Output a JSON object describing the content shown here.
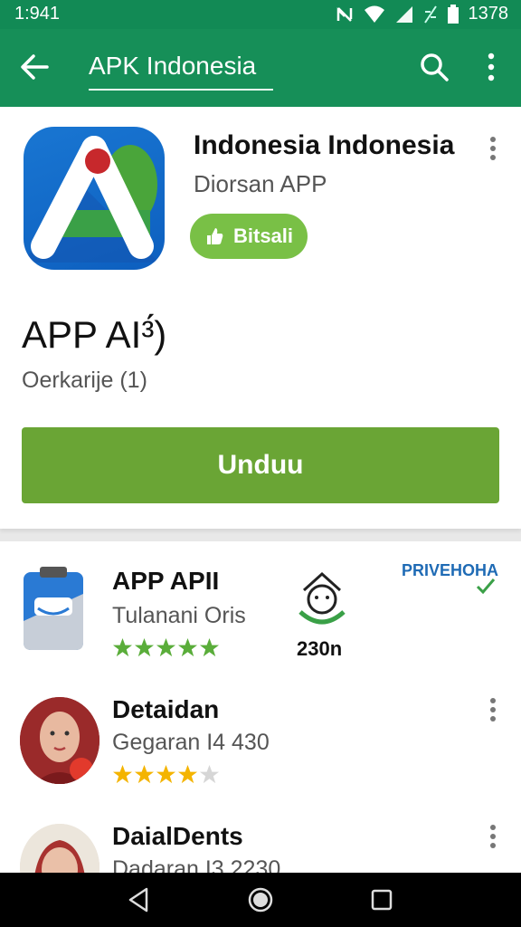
{
  "status_bar": {
    "time": "1:941",
    "battery_text": "1378"
  },
  "app_bar": {
    "search_text": "APK Indonesia"
  },
  "header": {
    "title": "Indonesia Indonesia",
    "subtitle": "Diorsan APP",
    "badge_label": "Bitsali",
    "app_name": "APP AI³́)",
    "review_count": "Oerkarije (1)",
    "install_label": "Unduu"
  },
  "list": {
    "brand": "PRIVEHOHA",
    "items": [
      {
        "title": "APP APII",
        "subtitle": "Tulanani Oris",
        "rating": 5,
        "count": "230n"
      },
      {
        "title": "Detaidan",
        "subtitle": "Gegaran I4 430",
        "rating": 4
      },
      {
        "title": "DaialDents",
        "subtitle": "Dadaran I3 2230"
      }
    ]
  },
  "colors": {
    "app_bar": "#168f58",
    "status_bar": "#128a55",
    "accent_green": "#6aa535",
    "pill_green": "#79c046",
    "star_green": "#5aad3a",
    "star_gold": "#f4b400",
    "brand_blue": "#1f6bb5"
  },
  "icons": [
    "back-arrow-icon",
    "search-icon",
    "more-vert-icon",
    "hand-icon",
    "star-icon",
    "nav-back-icon",
    "nav-home-icon",
    "nav-recents-icon"
  ]
}
